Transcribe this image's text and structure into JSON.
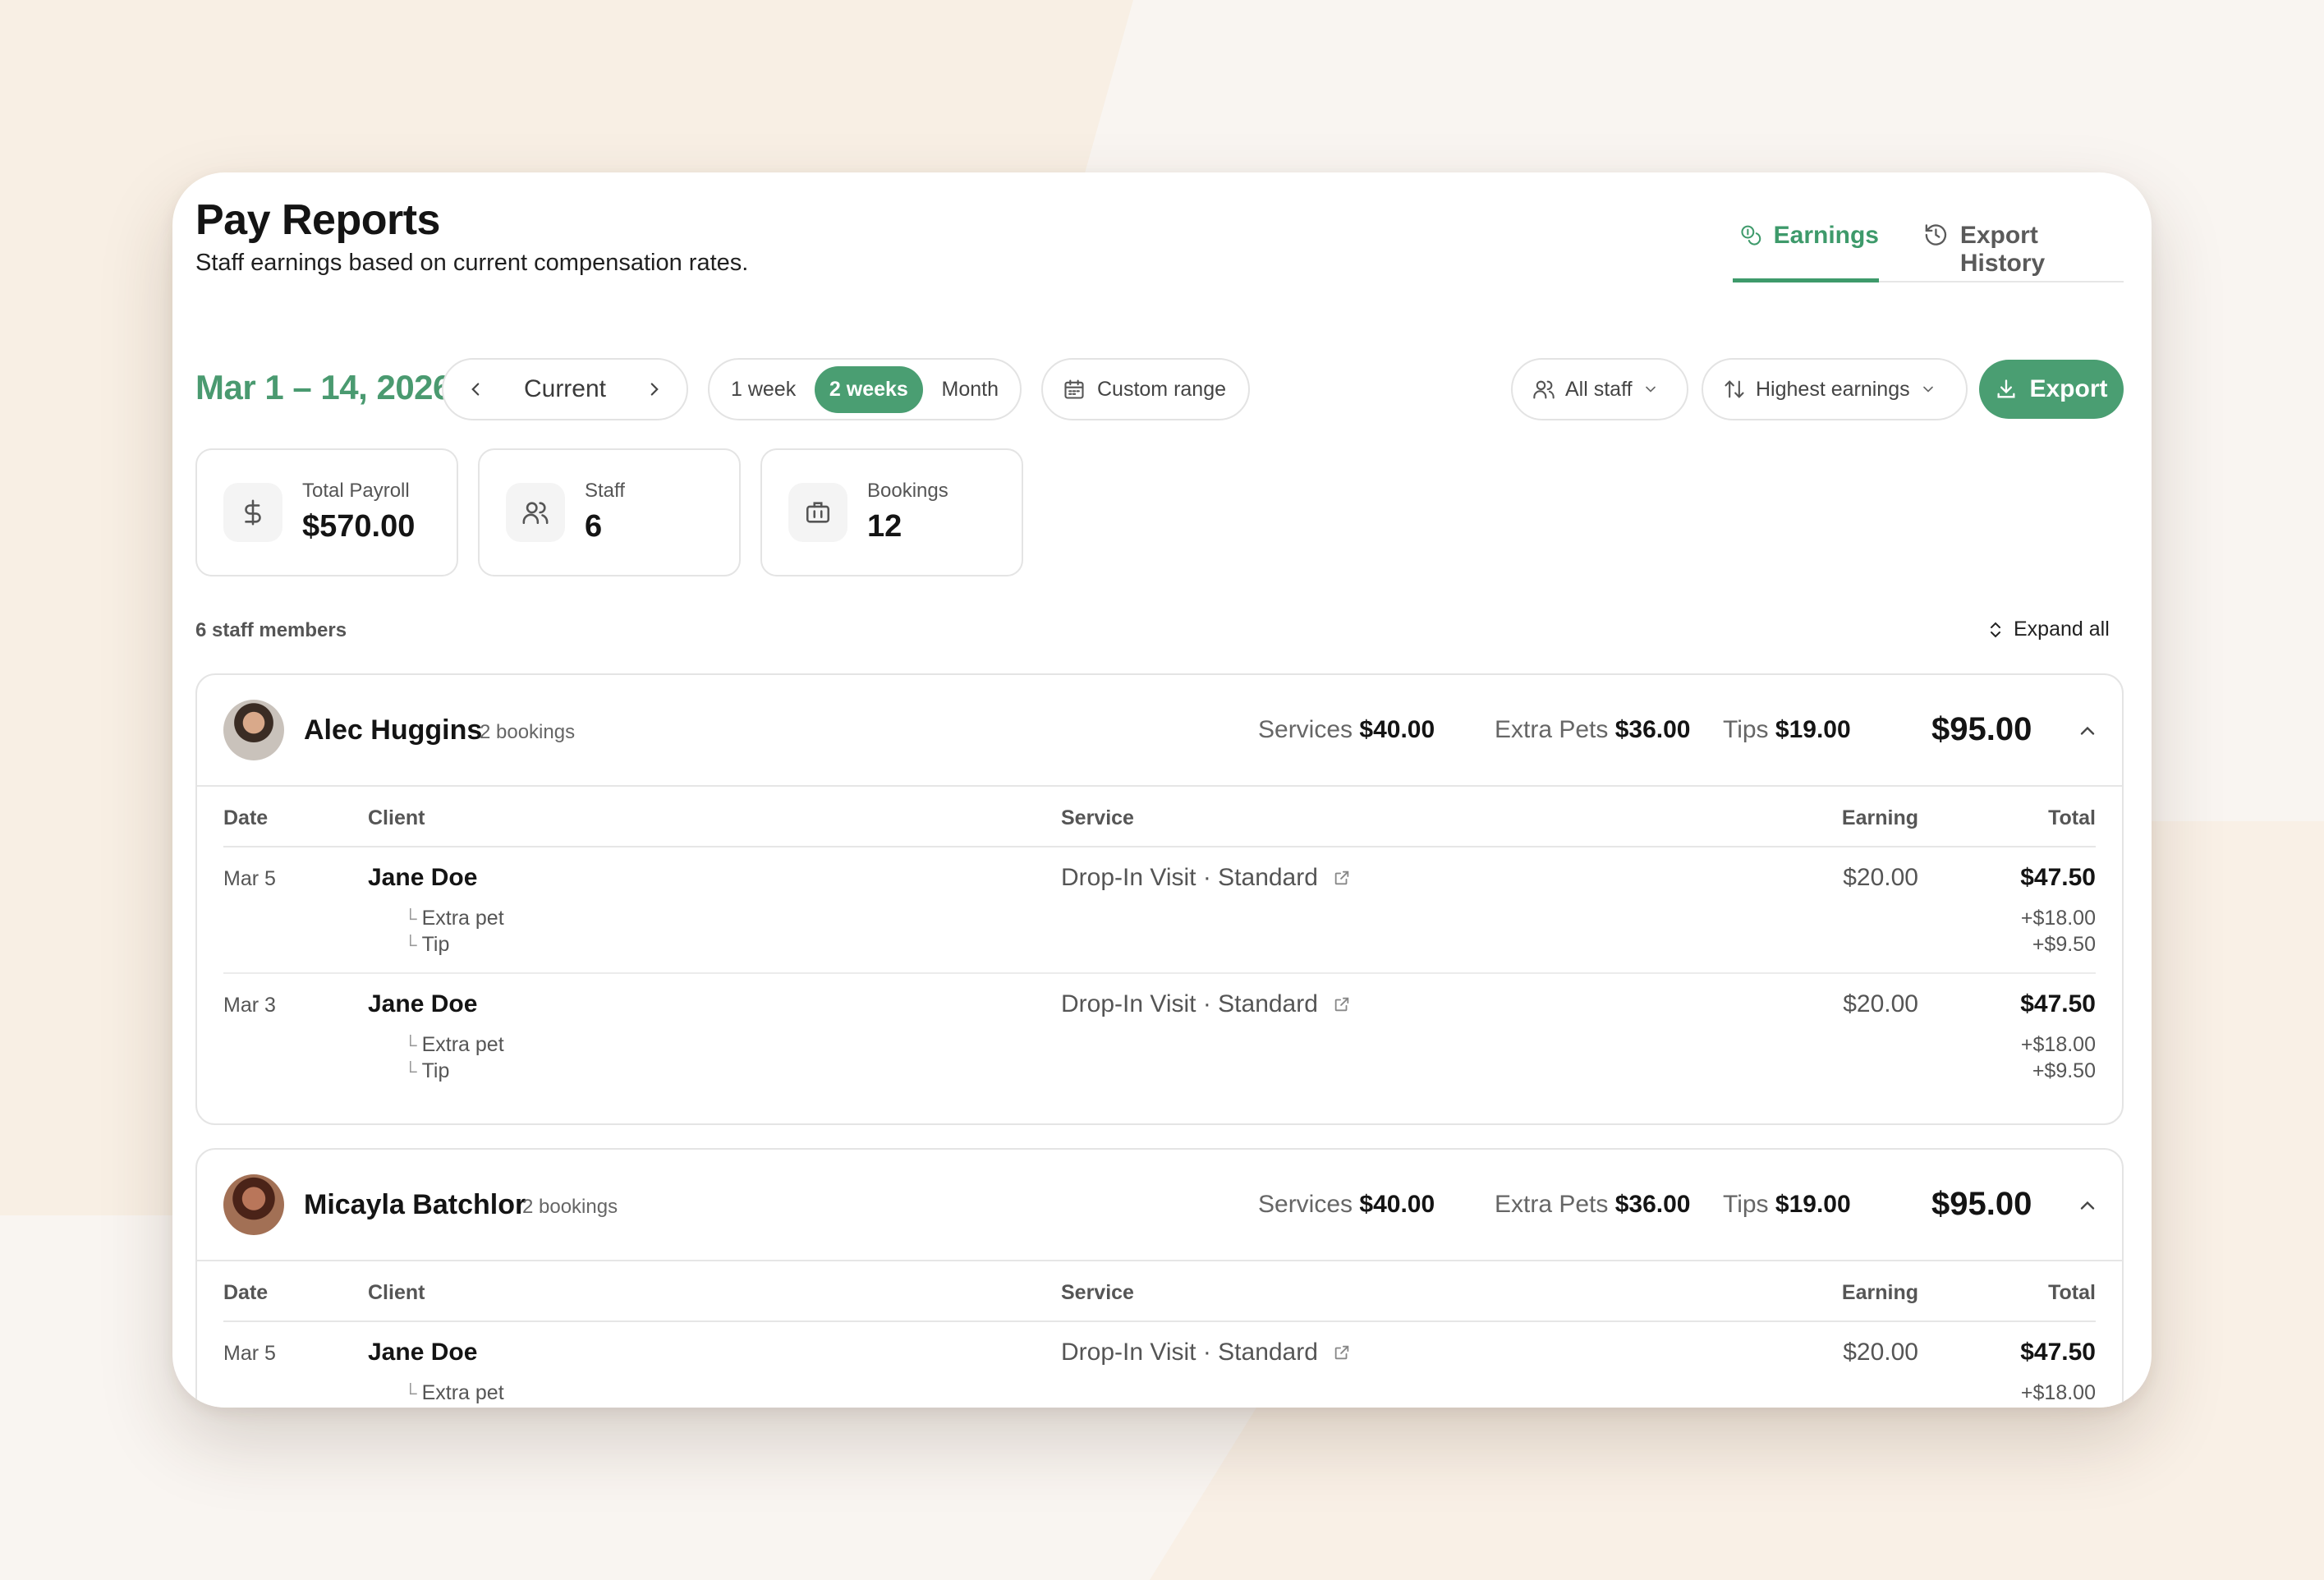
{
  "header": {
    "title": "Pay Reports",
    "subtitle": "Staff earnings based on current compensation rates."
  },
  "tabs": [
    {
      "label": "Earnings",
      "icon": "coins-icon",
      "active": true
    },
    {
      "label": "Export History",
      "icon": "history-icon",
      "active": false
    }
  ],
  "toolbar": {
    "date_range": "Mar 1 – 14, 2026",
    "period_label": "Current",
    "ranges": [
      "1 week",
      "2 weeks",
      "Month"
    ],
    "active_range": "2 weeks",
    "custom_range": "Custom range",
    "staff_filter": "All staff",
    "sort": "Highest earnings",
    "export": "Export"
  },
  "stats": [
    {
      "label": "Total Payroll",
      "value": "$570.00",
      "icon": "dollar-icon"
    },
    {
      "label": "Staff",
      "value": "6",
      "icon": "users-icon"
    },
    {
      "label": "Bookings",
      "value": "12",
      "icon": "briefcase-icon"
    }
  ],
  "list": {
    "count_label": "6 staff members",
    "expand_all": "Expand all",
    "columns": {
      "date": "Date",
      "client": "Client",
      "service": "Service",
      "earning": "Earning",
      "total": "Total"
    }
  },
  "staff": [
    {
      "name": "Alec Huggins",
      "bookings": "2 bookings",
      "services_label": "Services",
      "services": "$40.00",
      "extra_label": "Extra Pets",
      "extra": "$36.00",
      "tips_label": "Tips",
      "tips": "$19.00",
      "total": "$95.00",
      "rows": [
        {
          "date": "Mar 5",
          "client": "Jane Doe",
          "service": "Drop-In Visit · Standard",
          "earning": "$20.00",
          "total": "$47.50",
          "addons": [
            {
              "label": "Extra pet",
              "amount": "+$18.00"
            },
            {
              "label": "Tip",
              "amount": "+$9.50"
            }
          ]
        },
        {
          "date": "Mar 3",
          "client": "Jane Doe",
          "service": "Drop-In Visit · Standard",
          "earning": "$20.00",
          "total": "$47.50",
          "addons": [
            {
              "label": "Extra pet",
              "amount": "+$18.00"
            },
            {
              "label": "Tip",
              "amount": "+$9.50"
            }
          ]
        }
      ]
    },
    {
      "name": "Micayla Batchlor",
      "bookings": "2 bookings",
      "services_label": "Services",
      "services": "$40.00",
      "extra_label": "Extra Pets",
      "extra": "$36.00",
      "tips_label": "Tips",
      "tips": "$19.00",
      "total": "$95.00",
      "rows": [
        {
          "date": "Mar 5",
          "client": "Jane Doe",
          "service": "Drop-In Visit · Standard",
          "earning": "$20.00",
          "total": "$47.50",
          "addons": [
            {
              "label": "Extra pet",
              "amount": "+$18.00"
            }
          ]
        }
      ]
    }
  ],
  "colors": {
    "accent": "#4a9e72",
    "accent_text": "#3e9a6b",
    "background": "#f9f5f1"
  }
}
